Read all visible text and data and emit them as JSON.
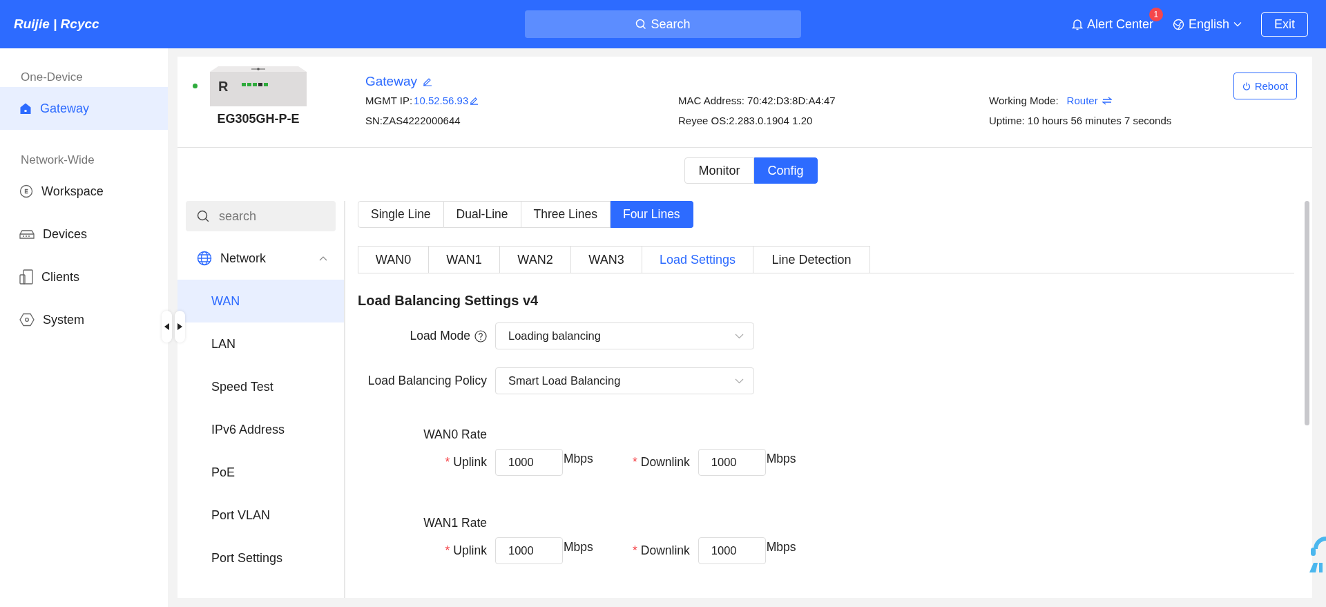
{
  "header": {
    "logo": "Ruijie | Rcycc",
    "search": "Search",
    "alert_label": "Alert Center",
    "alert_badge": "1",
    "language": "English",
    "exit": "Exit"
  },
  "sidebar": [
    {
      "title": "One-Device",
      "items": [
        {
          "label": "Gateway",
          "kind": "home",
          "selected": true
        }
      ]
    },
    {
      "title": "Network-Wide",
      "items": [
        {
          "label": "Workspace",
          "kind": "workspace",
          "selected": false
        },
        {
          "label": "Devices",
          "kind": "devices",
          "selected": false
        },
        {
          "label": "Clients",
          "kind": "clients",
          "selected": false
        },
        {
          "label": "System",
          "kind": "system",
          "selected": false
        }
      ]
    }
  ],
  "device": {
    "online": true,
    "front_label": "R",
    "model": "EG305GH-P-E",
    "name": "Gateway",
    "mgmt_ip_label": "MGMT IP:",
    "mgmt_ip": "10.52.56.93",
    "sn": "SN:ZAS4222000644",
    "mac": "MAC Address: 70:42:D3:8D:A4:47",
    "os": "Reyee OS:2.283.0.1904 1.20",
    "mode_label": "Working Mode:",
    "mode": "Router",
    "uptime": "Uptime: 10 hours 56 minutes 7 seconds",
    "reboot": "Reboot"
  },
  "view_tabs": [
    {
      "label": "Monitor",
      "selected": false
    },
    {
      "label": "Config",
      "selected": true
    }
  ],
  "menu": {
    "search_placeholder": "search",
    "group": {
      "label": "Network",
      "expanded": true,
      "items": [
        {
          "label": "WAN",
          "selected": true
        },
        {
          "label": "LAN",
          "selected": false
        },
        {
          "label": "Speed Test",
          "selected": false
        },
        {
          "label": "IPv6 Address",
          "selected": false
        },
        {
          "label": "PoE",
          "selected": false
        },
        {
          "label": "Port VLAN",
          "selected": false
        },
        {
          "label": "Port Settings",
          "selected": false
        }
      ]
    }
  },
  "line_tabs": [
    {
      "label": "Single Line",
      "selected": false
    },
    {
      "label": "Dual-Line",
      "selected": false
    },
    {
      "label": "Three Lines",
      "selected": false
    },
    {
      "label": "Four Lines",
      "selected": true
    }
  ],
  "wan_tabs": [
    {
      "label": "WAN0",
      "selected": false
    },
    {
      "label": "WAN1",
      "selected": false
    },
    {
      "label": "WAN2",
      "selected": false
    },
    {
      "label": "WAN3",
      "selected": false
    },
    {
      "label": "Load Settings",
      "selected": true
    },
    {
      "label": "Line Detection",
      "selected": false
    }
  ],
  "section_title": "Load Balancing Settings v4",
  "selects": [
    {
      "label": "Load Mode",
      "help": true,
      "value": "Loading balancing"
    },
    {
      "label": "Load Balancing Policy",
      "help": false,
      "value": "Smart Load Balancing"
    }
  ],
  "rates": [
    {
      "title": "WAN0 Rate",
      "uplink_label": "Uplink",
      "uplink": "1000",
      "downlink_label": "Downlink",
      "downlink": "1000",
      "unit_up": "Mbps",
      "unit_down": "Mbps",
      "required": "*"
    },
    {
      "title": "WAN1 Rate",
      "uplink_label": "Uplink",
      "uplink": "1000",
      "downlink_label": "Downlink",
      "downlink": "1000",
      "unit_up": "Mbps",
      "unit_down": "Mbps",
      "required": "*"
    }
  ]
}
